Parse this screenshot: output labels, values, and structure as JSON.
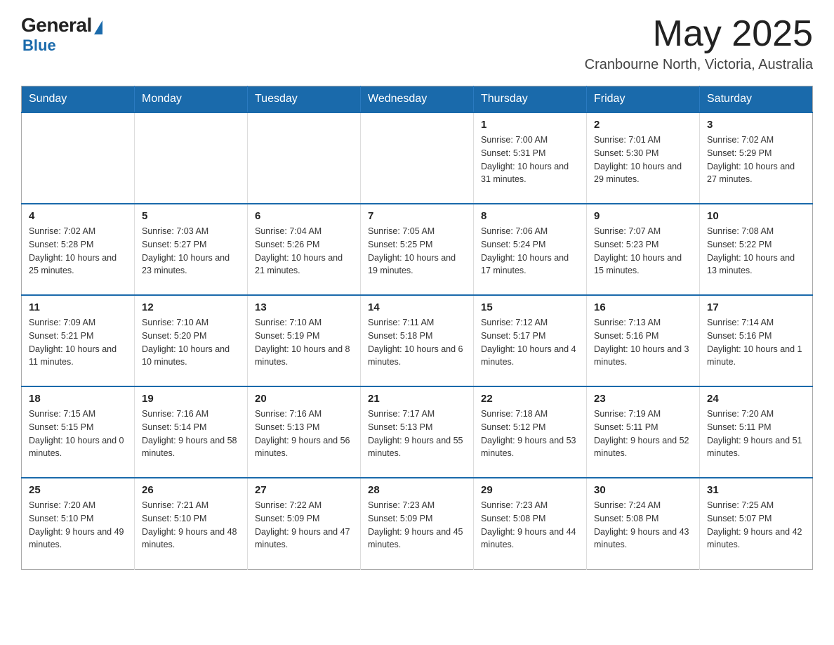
{
  "header": {
    "logo": {
      "general": "General",
      "blue": "Blue"
    },
    "title": "May 2025",
    "location": "Cranbourne North, Victoria, Australia"
  },
  "calendar": {
    "weekdays": [
      "Sunday",
      "Monday",
      "Tuesday",
      "Wednesday",
      "Thursday",
      "Friday",
      "Saturday"
    ],
    "weeks": [
      [
        {
          "day": "",
          "info": ""
        },
        {
          "day": "",
          "info": ""
        },
        {
          "day": "",
          "info": ""
        },
        {
          "day": "",
          "info": ""
        },
        {
          "day": "1",
          "info": "Sunrise: 7:00 AM\nSunset: 5:31 PM\nDaylight: 10 hours and 31 minutes."
        },
        {
          "day": "2",
          "info": "Sunrise: 7:01 AM\nSunset: 5:30 PM\nDaylight: 10 hours and 29 minutes."
        },
        {
          "day": "3",
          "info": "Sunrise: 7:02 AM\nSunset: 5:29 PM\nDaylight: 10 hours and 27 minutes."
        }
      ],
      [
        {
          "day": "4",
          "info": "Sunrise: 7:02 AM\nSunset: 5:28 PM\nDaylight: 10 hours and 25 minutes."
        },
        {
          "day": "5",
          "info": "Sunrise: 7:03 AM\nSunset: 5:27 PM\nDaylight: 10 hours and 23 minutes."
        },
        {
          "day": "6",
          "info": "Sunrise: 7:04 AM\nSunset: 5:26 PM\nDaylight: 10 hours and 21 minutes."
        },
        {
          "day": "7",
          "info": "Sunrise: 7:05 AM\nSunset: 5:25 PM\nDaylight: 10 hours and 19 minutes."
        },
        {
          "day": "8",
          "info": "Sunrise: 7:06 AM\nSunset: 5:24 PM\nDaylight: 10 hours and 17 minutes."
        },
        {
          "day": "9",
          "info": "Sunrise: 7:07 AM\nSunset: 5:23 PM\nDaylight: 10 hours and 15 minutes."
        },
        {
          "day": "10",
          "info": "Sunrise: 7:08 AM\nSunset: 5:22 PM\nDaylight: 10 hours and 13 minutes."
        }
      ],
      [
        {
          "day": "11",
          "info": "Sunrise: 7:09 AM\nSunset: 5:21 PM\nDaylight: 10 hours and 11 minutes."
        },
        {
          "day": "12",
          "info": "Sunrise: 7:10 AM\nSunset: 5:20 PM\nDaylight: 10 hours and 10 minutes."
        },
        {
          "day": "13",
          "info": "Sunrise: 7:10 AM\nSunset: 5:19 PM\nDaylight: 10 hours and 8 minutes."
        },
        {
          "day": "14",
          "info": "Sunrise: 7:11 AM\nSunset: 5:18 PM\nDaylight: 10 hours and 6 minutes."
        },
        {
          "day": "15",
          "info": "Sunrise: 7:12 AM\nSunset: 5:17 PM\nDaylight: 10 hours and 4 minutes."
        },
        {
          "day": "16",
          "info": "Sunrise: 7:13 AM\nSunset: 5:16 PM\nDaylight: 10 hours and 3 minutes."
        },
        {
          "day": "17",
          "info": "Sunrise: 7:14 AM\nSunset: 5:16 PM\nDaylight: 10 hours and 1 minute."
        }
      ],
      [
        {
          "day": "18",
          "info": "Sunrise: 7:15 AM\nSunset: 5:15 PM\nDaylight: 10 hours and 0 minutes."
        },
        {
          "day": "19",
          "info": "Sunrise: 7:16 AM\nSunset: 5:14 PM\nDaylight: 9 hours and 58 minutes."
        },
        {
          "day": "20",
          "info": "Sunrise: 7:16 AM\nSunset: 5:13 PM\nDaylight: 9 hours and 56 minutes."
        },
        {
          "day": "21",
          "info": "Sunrise: 7:17 AM\nSunset: 5:13 PM\nDaylight: 9 hours and 55 minutes."
        },
        {
          "day": "22",
          "info": "Sunrise: 7:18 AM\nSunset: 5:12 PM\nDaylight: 9 hours and 53 minutes."
        },
        {
          "day": "23",
          "info": "Sunrise: 7:19 AM\nSunset: 5:11 PM\nDaylight: 9 hours and 52 minutes."
        },
        {
          "day": "24",
          "info": "Sunrise: 7:20 AM\nSunset: 5:11 PM\nDaylight: 9 hours and 51 minutes."
        }
      ],
      [
        {
          "day": "25",
          "info": "Sunrise: 7:20 AM\nSunset: 5:10 PM\nDaylight: 9 hours and 49 minutes."
        },
        {
          "day": "26",
          "info": "Sunrise: 7:21 AM\nSunset: 5:10 PM\nDaylight: 9 hours and 48 minutes."
        },
        {
          "day": "27",
          "info": "Sunrise: 7:22 AM\nSunset: 5:09 PM\nDaylight: 9 hours and 47 minutes."
        },
        {
          "day": "28",
          "info": "Sunrise: 7:23 AM\nSunset: 5:09 PM\nDaylight: 9 hours and 45 minutes."
        },
        {
          "day": "29",
          "info": "Sunrise: 7:23 AM\nSunset: 5:08 PM\nDaylight: 9 hours and 44 minutes."
        },
        {
          "day": "30",
          "info": "Sunrise: 7:24 AM\nSunset: 5:08 PM\nDaylight: 9 hours and 43 minutes."
        },
        {
          "day": "31",
          "info": "Sunrise: 7:25 AM\nSunset: 5:07 PM\nDaylight: 9 hours and 42 minutes."
        }
      ]
    ]
  }
}
